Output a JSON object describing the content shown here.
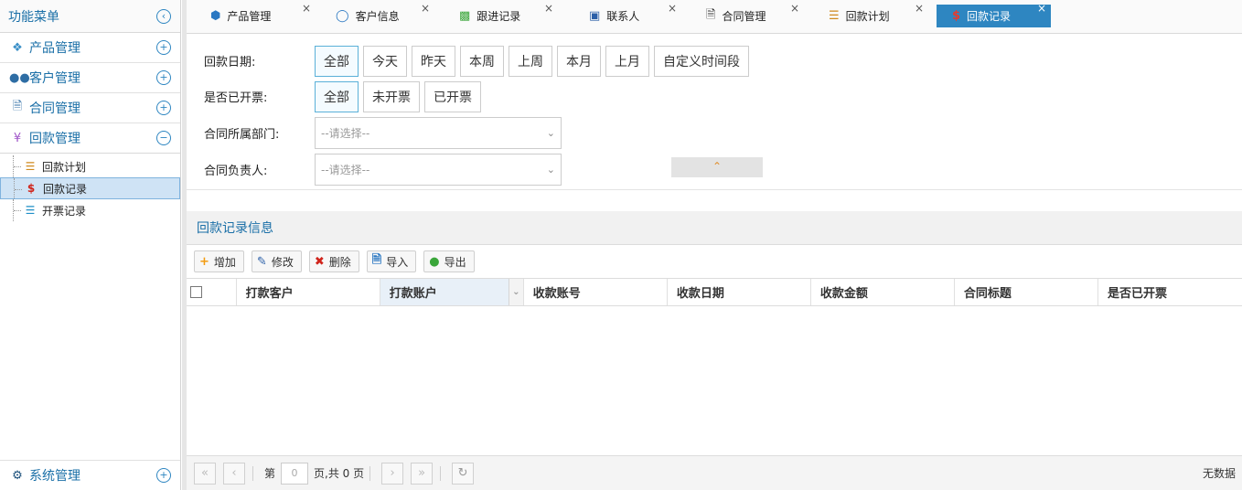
{
  "sidebar": {
    "title": "功能菜单",
    "groups": [
      {
        "label": "产品管理",
        "icon": "cubes-icon",
        "toggle": "+"
      },
      {
        "label": "客户管理",
        "icon": "users-icon",
        "toggle": "+"
      },
      {
        "label": "合同管理",
        "icon": "pdf-file-icon",
        "toggle": "+"
      },
      {
        "label": "回款管理",
        "icon": "yen-icon",
        "toggle": "−"
      }
    ],
    "tree": [
      {
        "label": "回款计划",
        "icon": "list-icon"
      },
      {
        "label": "回款记录",
        "icon": "dollar-icon"
      },
      {
        "label": "开票记录",
        "icon": "invoice-list-icon"
      }
    ],
    "bottom": {
      "label": "系统管理",
      "icon": "gear-icon",
      "toggle": "+"
    }
  },
  "tabs": [
    {
      "label": "产品管理",
      "icon": "cube-icon"
    },
    {
      "label": "客户信息",
      "icon": "user-icon"
    },
    {
      "label": "跟进记录",
      "icon": "contact-book-icon"
    },
    {
      "label": "联系人",
      "icon": "id-card-icon"
    },
    {
      "label": "合同管理",
      "icon": "document-icon"
    },
    {
      "label": "回款计划",
      "icon": "list-icon"
    },
    {
      "label": "回款记录",
      "icon": "dollar-icon"
    }
  ],
  "close_glyph": "×",
  "filters": {
    "date_label": "回款日期:",
    "date_options": [
      "全部",
      "今天",
      "昨天",
      "本周",
      "上周",
      "本月",
      "上月",
      "自定义时间段"
    ],
    "invoice_label": "是否已开票:",
    "invoice_options": [
      "全部",
      "未开票",
      "已开票"
    ],
    "dept_label": "合同所属部门:",
    "dept_placeholder": "--请选择--",
    "owner_label": "合同负责人:",
    "owner_placeholder": "--请选择--"
  },
  "panel": {
    "title": "回款记录信息"
  },
  "toolbar": {
    "add": "增加",
    "edit": "修改",
    "delete": "删除",
    "import": "导入",
    "export": "导出"
  },
  "grid": {
    "columns": [
      "打款客户",
      "打款账户",
      "收款账号",
      "收款日期",
      "收款金额",
      "合同标题",
      "是否已开票"
    ]
  },
  "pager": {
    "page_prefix": "第",
    "page_value": "0",
    "page_suffix": "页,共 0 页",
    "empty_text": "无数据"
  },
  "colors": {
    "accent": "#2e86c1",
    "link_blue": "#1a6fa7",
    "active_tree_bg": "#cfe3f5"
  }
}
